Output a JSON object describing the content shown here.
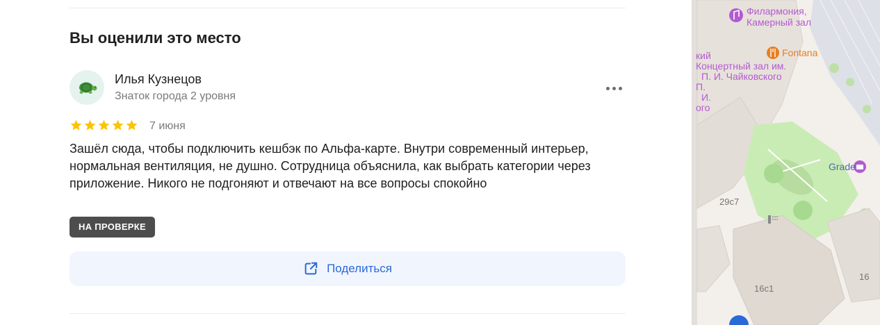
{
  "review_section": {
    "title": "Вы оценили это место",
    "user": {
      "name": "Илья Кузнецов",
      "rank": "Знаток города 2 уровня",
      "avatar": "turtle-icon"
    },
    "rating": 5,
    "rating_max": 5,
    "date": "7 июня",
    "text": "Зашёл сюда, чтобы подключить кешбэк по Альфа-карте. Внутри современный интерьер, нормальная вентиляция, не душно. Сотрудница объяснила, как выбрать категории через приложение. Никого не подгоняют и отвечают на все вопросы спокойно",
    "status_badge": "НА ПРОВЕРКЕ",
    "share_label": "Поделиться"
  },
  "map": {
    "labels": {
      "philharmonia": [
        "Филармония,",
        "Камерный зал"
      ],
      "fontana": "Fontana",
      "concert_hall": [
        "кий",
        "Концертный зал им.",
        "П. И. Чайковского",
        "П.",
        "И.",
        "ого"
      ],
      "grade": "Grade",
      "building_29c7": "29с7",
      "building_16c1": "16с1",
      "building_16": "16"
    }
  },
  "colors": {
    "star": "#fcc400",
    "accent": "#2a6ad8",
    "badge_bg": "#4d4d4d",
    "map_poi": "#b35bd1",
    "map_food": "#e97e1f",
    "map_park": "#c9ecb5"
  }
}
